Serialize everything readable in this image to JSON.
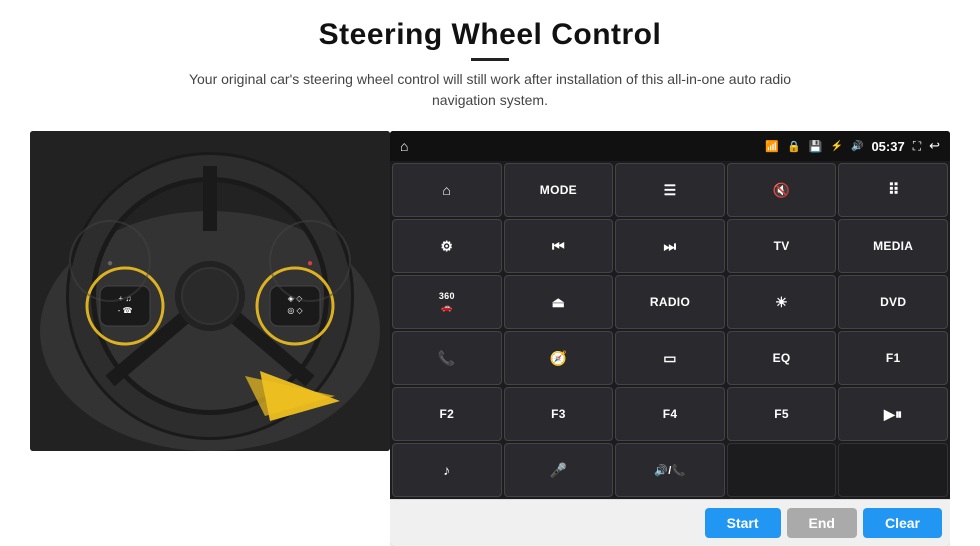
{
  "page": {
    "title": "Steering Wheel Control",
    "subtitle": "Your original car's steering wheel control will still work after installation of this all-in-one auto radio navigation system.",
    "divider": "—"
  },
  "status_bar": {
    "time": "05:37",
    "icons": [
      "wifi",
      "lock",
      "sd",
      "bt",
      "vol"
    ]
  },
  "grid_buttons": [
    {
      "id": "home",
      "label": "",
      "icon": "home",
      "row": 1
    },
    {
      "id": "mode",
      "label": "MODE",
      "icon": "",
      "row": 1
    },
    {
      "id": "list",
      "label": "",
      "icon": "list",
      "row": 1
    },
    {
      "id": "vol-mute",
      "label": "",
      "icon": "vol-mute",
      "row": 1
    },
    {
      "id": "apps",
      "label": "",
      "icon": "apps",
      "row": 1
    },
    {
      "id": "settings",
      "label": "",
      "icon": "settings",
      "row": 2
    },
    {
      "id": "prev",
      "label": "",
      "icon": "prev",
      "row": 2
    },
    {
      "id": "next",
      "label": "",
      "icon": "next",
      "row": 2
    },
    {
      "id": "tv",
      "label": "TV",
      "icon": "",
      "row": 2
    },
    {
      "id": "media",
      "label": "MEDIA",
      "icon": "",
      "row": 2
    },
    {
      "id": "360cam",
      "label": "",
      "icon": "360",
      "row": 3
    },
    {
      "id": "eject",
      "label": "",
      "icon": "eject",
      "row": 3
    },
    {
      "id": "radio",
      "label": "RADIO",
      "icon": "",
      "row": 3
    },
    {
      "id": "brightness",
      "label": "",
      "icon": "brightness",
      "row": 3
    },
    {
      "id": "dvd",
      "label": "DVD",
      "icon": "",
      "row": 3
    },
    {
      "id": "phone",
      "label": "",
      "icon": "phone",
      "row": 4
    },
    {
      "id": "navi",
      "label": "",
      "icon": "navi",
      "row": 4
    },
    {
      "id": "mirror",
      "label": "",
      "icon": "mirror",
      "row": 4
    },
    {
      "id": "eq",
      "label": "EQ",
      "icon": "",
      "row": 4
    },
    {
      "id": "f1",
      "label": "F1",
      "icon": "",
      "row": 4
    },
    {
      "id": "f2",
      "label": "F2",
      "icon": "",
      "row": 5
    },
    {
      "id": "f3",
      "label": "F3",
      "icon": "",
      "row": 5
    },
    {
      "id": "f4",
      "label": "F4",
      "icon": "",
      "row": 5
    },
    {
      "id": "f5",
      "label": "F5",
      "icon": "",
      "row": 5
    },
    {
      "id": "play-pause",
      "label": "",
      "icon": "play-pause",
      "row": 5
    },
    {
      "id": "music",
      "label": "",
      "icon": "music",
      "row": 6
    },
    {
      "id": "mic",
      "label": "",
      "icon": "mic",
      "row": 6
    },
    {
      "id": "vol-phone",
      "label": "",
      "icon": "vol-phone",
      "row": 6
    },
    {
      "id": "empty1",
      "label": "",
      "icon": "",
      "row": 6
    },
    {
      "id": "empty2",
      "label": "",
      "icon": "",
      "row": 6
    }
  ],
  "bottom_bar": {
    "start_label": "Start",
    "end_label": "End",
    "clear_label": "Clear"
  },
  "colors": {
    "accent_blue": "#2196F3",
    "btn_disabled": "#aaaaaa",
    "grid_bg": "#2a2a2e",
    "status_bg": "#111111",
    "body_bg": "#ffffff"
  }
}
